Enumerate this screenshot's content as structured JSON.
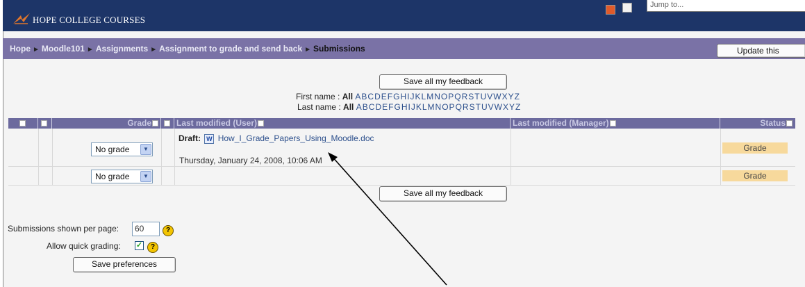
{
  "header": {
    "site_name": "HOPE COLLEGE COURSES",
    "jump_to_placeholder": "Jump to..."
  },
  "breadcrumb": {
    "items": [
      "Hope",
      "Moodle101",
      "Assignments",
      "Assignment to grade and send back"
    ],
    "current": "Submissions",
    "separator": "►"
  },
  "update_button": "Update this",
  "save_feedback_label": "Save all my feedback",
  "filters": {
    "first_name_label": "First name :",
    "last_name_label": "Last name :",
    "all_label": "All",
    "letters": [
      "A",
      "B",
      "C",
      "D",
      "E",
      "F",
      "G",
      "H",
      "I",
      "J",
      "K",
      "L",
      "M",
      "N",
      "O",
      "P",
      "Q",
      "R",
      "S",
      "T",
      "U",
      "V",
      "W",
      "X",
      "Y",
      "Z"
    ]
  },
  "table": {
    "headers": {
      "grade": "Grade",
      "last_modified_user": "Last modified (User)",
      "last_modified_manager": "Last modified (Manager)",
      "status": "Status"
    },
    "rows": [
      {
        "grade_select": "No grade",
        "draft_label": "Draft:",
        "file_name": "How_I_Grade_Papers_Using_Moodle.doc",
        "modified_date": "Thursday, January 24, 2008, 10:06 AM",
        "status": "Grade"
      },
      {
        "grade_select": "No grade",
        "status": "Grade"
      }
    ]
  },
  "preferences": {
    "per_page_label": "Submissions shown per page:",
    "per_page_value": "60",
    "quick_grading_label": "Allow quick grading:",
    "quick_grading_checked": true,
    "save_label": "Save preferences"
  },
  "colors": {
    "header_bg": "#1d3568",
    "nav_bg": "#7a72a6",
    "table_header_bg": "#6c6a9e",
    "grade_badge": "#f7d99c"
  }
}
